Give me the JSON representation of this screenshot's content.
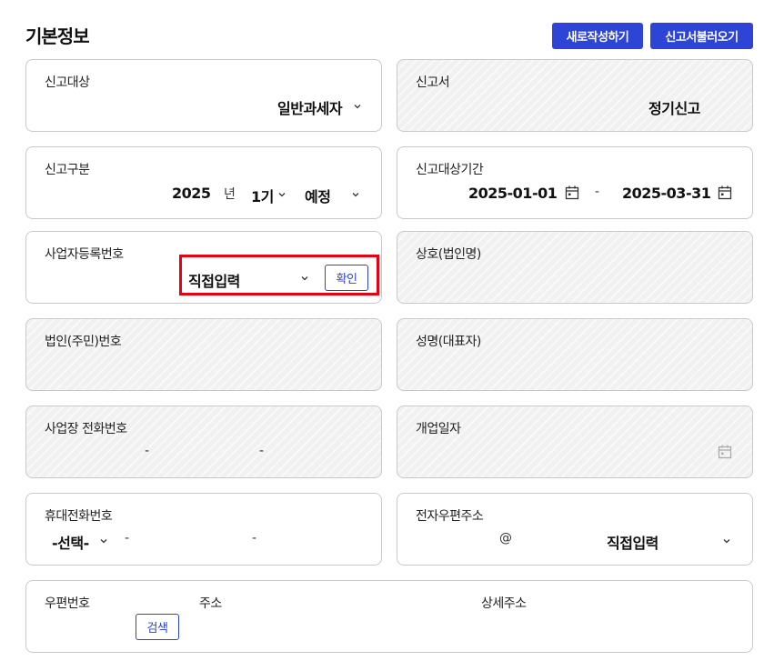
{
  "header": {
    "title": "기본정보",
    "new_button": "새로작성하기",
    "load_button": "신고서불러오기"
  },
  "report_target": {
    "label": "신고대상",
    "value": "일반과세자"
  },
  "report_form": {
    "label": "신고서",
    "value": "정기신고"
  },
  "report_type": {
    "label": "신고구분",
    "year": "2025",
    "year_unit": "년",
    "period": "1기",
    "kind": "예정"
  },
  "report_period": {
    "label": "신고대상기간",
    "start": "2025-01-01",
    "separator": "-",
    "end": "2025-03-31"
  },
  "business_reg": {
    "label": "사업자등록번호",
    "mode": "직접입력",
    "confirm": "확인"
  },
  "company_name": {
    "label": "상호(법인명)"
  },
  "corp_number": {
    "label": "법인(주민)번호"
  },
  "rep_name": {
    "label": "성명(대표자)"
  },
  "biz_phone": {
    "label": "사업장 전화번호",
    "sep1": "-",
    "sep2": "-"
  },
  "open_date": {
    "label": "개업일자"
  },
  "mobile": {
    "label": "휴대전화번호",
    "prefix": "-선택-",
    "sep1": "-",
    "sep2": "-"
  },
  "email": {
    "label": "전자우편주소",
    "at": "@",
    "domain_mode": "직접입력"
  },
  "address": {
    "zip_label": "우편번호",
    "addr_label": "주소",
    "detail_label": "상세주소",
    "search": "검색"
  },
  "colors": {
    "accent": "#2e44d6",
    "highlight": "#e60012"
  }
}
